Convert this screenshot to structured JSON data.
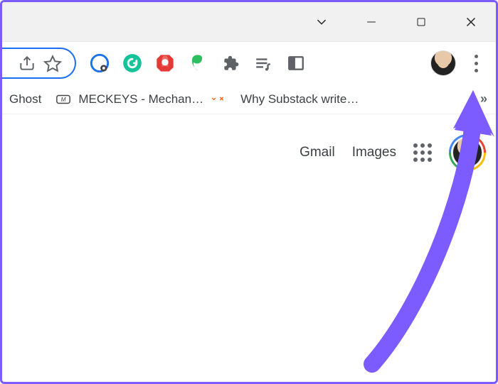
{
  "window": {
    "controls": {
      "dropdown": "v",
      "minimize": "—",
      "maximize": "□",
      "close": "✕"
    }
  },
  "toolbar": {
    "share_icon": "share-icon",
    "star_icon": "bookmark-star-icon",
    "extensions": [
      {
        "name": "cookie-autodelete-icon",
        "color": "#1a73e8"
      },
      {
        "name": "grammarly-icon",
        "color": "#15c39a"
      },
      {
        "name": "adblock-icon",
        "color": "#e53935"
      },
      {
        "name": "evernote-icon",
        "color": "#2dbe60"
      },
      {
        "name": "extensions-puzzle-icon",
        "color": "#5f6368"
      },
      {
        "name": "playlist-icon",
        "color": "#5f6368"
      },
      {
        "name": "side-panel-icon",
        "color": "#5f6368"
      }
    ],
    "profile": "user-avatar",
    "menu": "three-dot-menu"
  },
  "bookmarks": {
    "items": [
      {
        "favicon": "ghost-icon",
        "label": "Ghost"
      },
      {
        "favicon": "meckeys-icon",
        "label": "MECKEYS - Mechan…"
      },
      {
        "favicon": "substack-icon",
        "label": "Why Substack write…"
      }
    ],
    "overflow": "»"
  },
  "content": {
    "links": {
      "gmail": "Gmail",
      "images": "Images"
    },
    "apps_icon": "google-apps-icon",
    "account": "google-account-avatar"
  },
  "annotation": {
    "arrow": "purple-arrow"
  }
}
